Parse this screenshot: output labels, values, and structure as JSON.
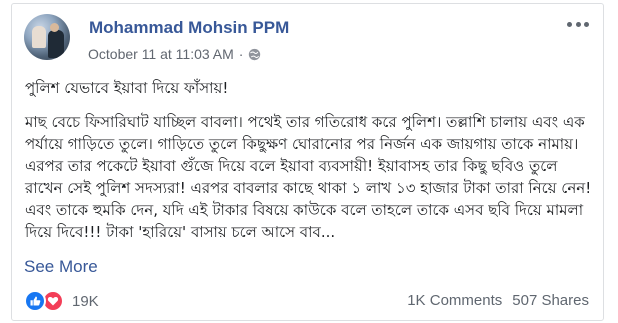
{
  "post": {
    "author": "Mohammad Mohsin PPM",
    "date": "October 11 at 11:03 AM",
    "separator": "·",
    "privacy_icon": "globe-icon",
    "title": "পুলিশ যেভাবে ইয়াবা দিয়ে ফাঁসায়!",
    "body": "মাছ বেচে ফিসারিঘাট যাচ্ছিল বাবলা। পথেই তার গতিরোধ করে পুলিশ। তল্লাশি চালায় এবং এক পর্যায়ে গাড়িতে তুলে। গাড়িতে তুলে কিছুক্ষণ ঘোরানোর পর নির্জন এক জায়গায় তাকে নামায়। এরপর তার পকেটে ইয়াবা গুঁজে দিয়ে বলে ইয়াবা ব্যবসায়ী! ইয়াবাসহ তার কিছু ছবিও তুলে রাখেন সেই পুলিশ সদস্যরা! এরপর বাবলার কাছে থাকা ১ লাখ ১৩ হাজার টাকা তারা নিয়ে নেন! এবং তাকে হুমকি দেন, যদি এই টাকার বিষয়ে কাউকে বলে তাহলে তাকে এসব ছবি দিয়ে মামলা দিয়ে দিবে!!! টাকা 'হারিয়ে' বাসায় চলে আসে বাব...",
    "see_more": "See More"
  },
  "footer": {
    "reaction_icons": [
      "like-icon",
      "love-icon"
    ],
    "reaction_count": "19K",
    "comments": "1K Comments",
    "shares": "507 Shares"
  },
  "colors": {
    "link": "#385898",
    "meta": "#616770",
    "like": "#1877f2",
    "love": "#f33e58"
  }
}
